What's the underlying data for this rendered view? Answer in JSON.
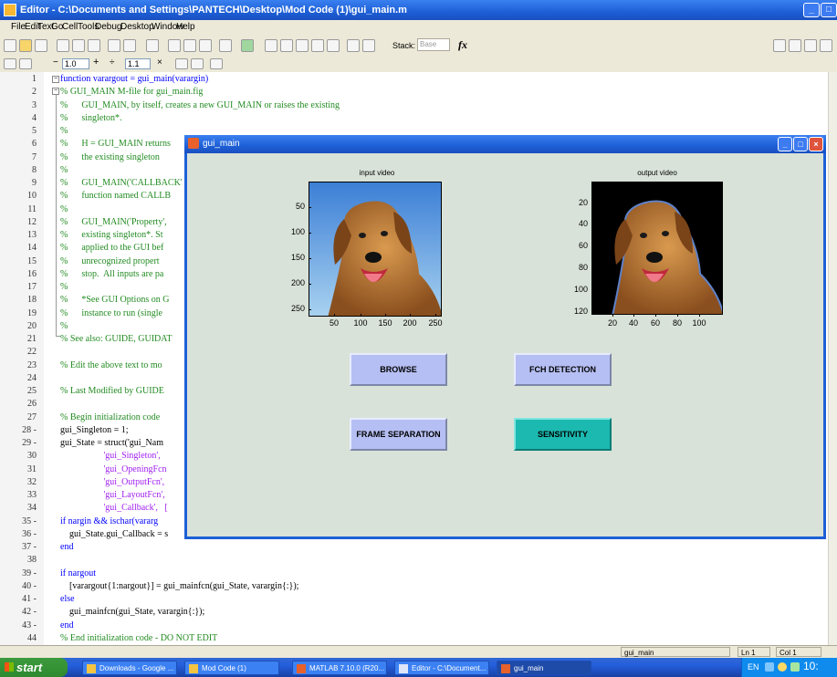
{
  "editor": {
    "title": "Editor - C:\\Documents and Settings\\PANTECH\\Desktop\\Mod Code (1)\\gui_main.m",
    "menus": [
      "File",
      "Edit",
      "Text",
      "Go",
      "Cell",
      "Tools",
      "Debug",
      "Desktop",
      "Window",
      "Help"
    ],
    "stack_label": "Stack:",
    "stack_value": "Base",
    "fx_label": "fx",
    "zoom_value1": "1.0",
    "zoom_value2": "1.1",
    "lines": [
      {
        "n": "1",
        "t": "function varargout = gui_main(varargin)",
        "c": "kw"
      },
      {
        "n": "2",
        "t": "% GUI_MAIN M-file for gui_main.fig",
        "c": "cmt"
      },
      {
        "n": "3",
        "t": "%      GUI_MAIN, by itself, creates a new GUI_MAIN or raises the existing",
        "c": "cmt"
      },
      {
        "n": "4",
        "t": "%      singleton*.",
        "c": "cmt"
      },
      {
        "n": "5",
        "t": "%",
        "c": "cmt"
      },
      {
        "n": "6",
        "t": "%      H = GUI_MAIN returns",
        "c": "cmt"
      },
      {
        "n": "7",
        "t": "%      the existing singleton",
        "c": "cmt"
      },
      {
        "n": "8",
        "t": "%",
        "c": "cmt"
      },
      {
        "n": "9",
        "t": "%      GUI_MAIN('CALLBACK'",
        "c": "cmt"
      },
      {
        "n": "10",
        "t": "%      function named CALLB",
        "c": "cmt"
      },
      {
        "n": "11",
        "t": "%",
        "c": "cmt"
      },
      {
        "n": "12",
        "t": "%      GUI_MAIN('Property',",
        "c": "cmt"
      },
      {
        "n": "13",
        "t": "%      existing singleton*. St",
        "c": "cmt"
      },
      {
        "n": "14",
        "t": "%      applied to the GUI bef",
        "c": "cmt"
      },
      {
        "n": "15",
        "t": "%      unrecognized propert",
        "c": "cmt"
      },
      {
        "n": "16",
        "t": "%      stop.  All inputs are pa",
        "c": "cmt"
      },
      {
        "n": "17",
        "t": "%",
        "c": "cmt"
      },
      {
        "n": "18",
        "t": "%      *See GUI Options on G",
        "c": "cmt"
      },
      {
        "n": "19",
        "t": "%      instance to run (single",
        "c": "cmt"
      },
      {
        "n": "20",
        "t": "%",
        "c": "cmt"
      },
      {
        "n": "21",
        "t": "% See also: GUIDE, GUIDAT",
        "c": "cmt"
      },
      {
        "n": "22",
        "t": "",
        "c": ""
      },
      {
        "n": "23",
        "t": "% Edit the above text to mo",
        "c": "cmt"
      },
      {
        "n": "24",
        "t": "",
        "c": ""
      },
      {
        "n": "25",
        "t": "% Last Modified by GUIDE",
        "c": "cmt"
      },
      {
        "n": "26",
        "t": "",
        "c": ""
      },
      {
        "n": "27",
        "t": "% Begin initialization code",
        "c": "cmt"
      },
      {
        "n": "28 -",
        "t": "gui_Singleton = 1;",
        "c": ""
      },
      {
        "n": "29 -",
        "t": "gui_State = struct('gui_Nam",
        "c": "mix1"
      },
      {
        "n": "30",
        "t": "                   'gui_Singleton',",
        "c": "str"
      },
      {
        "n": "31",
        "t": "                   'gui_OpeningFcn",
        "c": "str"
      },
      {
        "n": "32",
        "t": "                   'gui_OutputFcn',",
        "c": "str"
      },
      {
        "n": "33",
        "t": "                   'gui_LayoutFcn',",
        "c": "str"
      },
      {
        "n": "34",
        "t": "                   'gui_Callback',   [",
        "c": "str"
      },
      {
        "n": "35 -",
        "t": "if nargin && ischar(vararg",
        "c": "kw"
      },
      {
        "n": "36 -",
        "t": "    gui_State.gui_Callback = s",
        "c": ""
      },
      {
        "n": "37 -",
        "t": "end",
        "c": "kw"
      },
      {
        "n": "38",
        "t": "",
        "c": ""
      },
      {
        "n": "39 -",
        "t": "if nargout",
        "c": "kw"
      },
      {
        "n": "40 -",
        "t": "    [varargout{1:nargout}] = gui_mainfcn(gui_State, varargin{:});",
        "c": ""
      },
      {
        "n": "41 -",
        "t": "else",
        "c": "kw"
      },
      {
        "n": "42 -",
        "t": "    gui_mainfcn(gui_State, varargin{:});",
        "c": ""
      },
      {
        "n": "43 -",
        "t": "end",
        "c": "kw"
      },
      {
        "n": "44",
        "t": "% End initialization code - DO NOT EDIT",
        "c": "cmt"
      }
    ],
    "status": {
      "file": "gui_main",
      "ln_label": "Ln",
      "ln": "1",
      "col_label": "Col",
      "col": "1"
    }
  },
  "gui": {
    "title": "gui_main",
    "input_axes": {
      "title": "input video",
      "xticks": [
        "50",
        "100",
        "150",
        "200",
        "250"
      ],
      "yticks": [
        "50",
        "100",
        "150",
        "200",
        "250"
      ]
    },
    "output_axes": {
      "title": "output video",
      "xticks": [
        "20",
        "40",
        "60",
        "80",
        "100"
      ],
      "yticks": [
        "20",
        "40",
        "60",
        "80",
        "100",
        "120"
      ]
    },
    "buttons": {
      "browse": "BROWSE",
      "fch": "FCH DETECTION",
      "frame": "FRAME SEPARATION",
      "sensitivity": "SENSITIVITY"
    }
  },
  "taskbar": {
    "start": "start",
    "tasks": [
      {
        "label": "Downloads - Google ..."
      },
      {
        "label": "Mod Code (1)"
      },
      {
        "label": "MATLAB 7.10.0 (R20..."
      },
      {
        "label": "Editor - C:\\Document..."
      },
      {
        "label": "gui_main"
      }
    ],
    "tray_lang": "EN",
    "clock": "10:"
  },
  "colors": {
    "xp_blue": "#1d5fd6",
    "gui_bg": "#d9e2d8",
    "browse_btn": "#b6bff3",
    "sensitivity_btn": "#1bb9b0",
    "comment": "#228b22",
    "keyword": "#0000ff",
    "string": "#a020f0"
  }
}
